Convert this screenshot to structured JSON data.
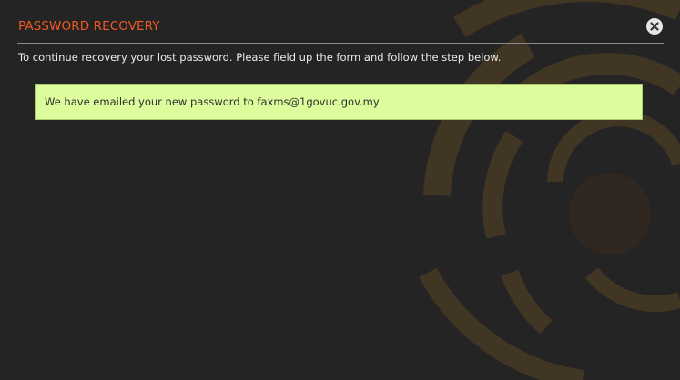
{
  "dialog": {
    "title": "PASSWORD RECOVERY",
    "close_icon": "close-icon",
    "instructions": "To continue recovery your lost password. Please field up the form and follow the step below.",
    "alert_message": "We have emailed your new password to faxms@1govuc.gov.my"
  },
  "colors": {
    "background": "#242424",
    "title": "#f05a22",
    "alert_background": "#dcfd9b",
    "alert_border": "#a9c96a",
    "decor_arcs": "#5a4324"
  }
}
